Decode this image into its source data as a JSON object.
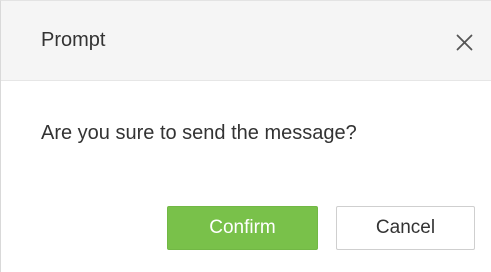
{
  "dialog": {
    "title": "Prompt",
    "close_icon": "close-icon",
    "message": "Are you sure to send the message?",
    "buttons": {
      "confirm_label": "Confirm",
      "cancel_label": "Cancel"
    }
  },
  "colors": {
    "header_background": "#f5f5f5",
    "confirm_background": "#79c14a",
    "confirm_text": "#ffffff",
    "cancel_background": "#ffffff",
    "text": "#333333"
  }
}
